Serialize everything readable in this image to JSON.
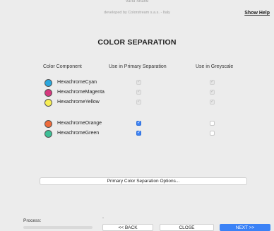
{
  "header": {
    "top_cut_text": "Vanu Shane",
    "developer": "developed by Colorstream s.a.s. - Italy",
    "help_link": "Show Help"
  },
  "title": "COLOR SEPARATION",
  "columns": {
    "component": "Color Component",
    "primary": "Use in Primary Separation",
    "greyscale": "Use in Greyscale"
  },
  "components": [
    {
      "name": "HexachromeCyan",
      "color": "#2aa7de",
      "primary": "checked-disabled",
      "greyscale": "checked-disabled"
    },
    {
      "name": "HexachromeMagenta",
      "color": "#d6387e",
      "primary": "checked-disabled",
      "greyscale": "checked-disabled"
    },
    {
      "name": "HexachromeYellow",
      "color": "#f7ee55",
      "primary": "checked-disabled",
      "greyscale": "checked-disabled"
    },
    {
      "name": "HexachromeOrange",
      "color": "#ee6b3b",
      "primary": "checked",
      "greyscale": "unchecked"
    },
    {
      "name": "HexachromeGreen",
      "color": "#3dbf96",
      "primary": "checked",
      "greyscale": "unchecked"
    }
  ],
  "options_button": "Primary Color Separation Options...",
  "footer": {
    "process_label": "Process:",
    "process_value": "-",
    "progress": 0,
    "back": "<< BACK",
    "close": "CLOSE",
    "next": "NEXT >>"
  }
}
